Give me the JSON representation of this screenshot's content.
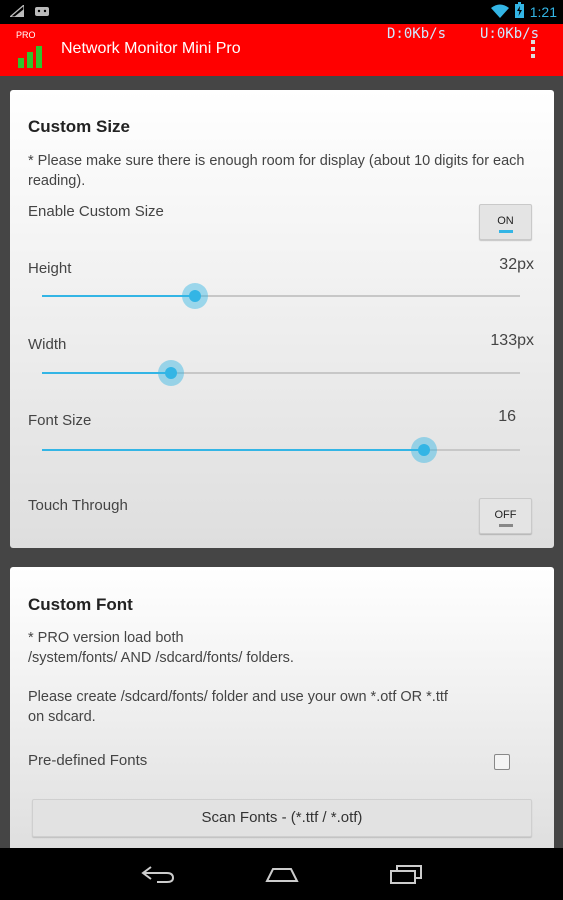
{
  "status_bar": {
    "time": "1:21",
    "icons": [
      "signal-icon",
      "android-debug-icon",
      "wifi-icon",
      "battery-icon"
    ]
  },
  "app_bar": {
    "title": "Network Monitor Mini Pro",
    "badge": "PRO",
    "download_rate": "D:0Kb/s",
    "upload_rate": "U:0Kb/s",
    "brand_color": "#ff0000"
  },
  "custom_size": {
    "title": "Custom Size",
    "note": "* Please make sure there is enough room for display (about 10 digits for each reading).",
    "enable": {
      "label": "Enable Custom Size",
      "toggle": "ON",
      "state": true
    },
    "height": {
      "label": "Height",
      "value": "32px",
      "level": 0.32
    },
    "width": {
      "label": "Width",
      "value": "133px",
      "level": 0.27
    },
    "font_size": {
      "label": "Font Size",
      "value": "16",
      "level": 0.8
    },
    "touch_through": {
      "label": "Touch Through",
      "toggle": "OFF",
      "state": false
    }
  },
  "custom_font": {
    "title": "Custom Font",
    "note1_line1": "* PRO version load both",
    "note1_line2": "/system/fonts/ AND /sdcard/fonts/ folders.",
    "note2_line1": "Please create /sdcard/fonts/ folder and use your own *.otf OR *.ttf",
    "note2_line2": "on sdcard.",
    "predefined": {
      "label": "Pre-defined Fonts",
      "checked": false
    },
    "scan_button": "Scan Fonts - (*.ttf / *.otf)"
  },
  "nav_bar": {
    "icons": [
      "back-icon",
      "home-icon",
      "recents-icon"
    ]
  },
  "colors": {
    "accent": "#33b5e5"
  }
}
